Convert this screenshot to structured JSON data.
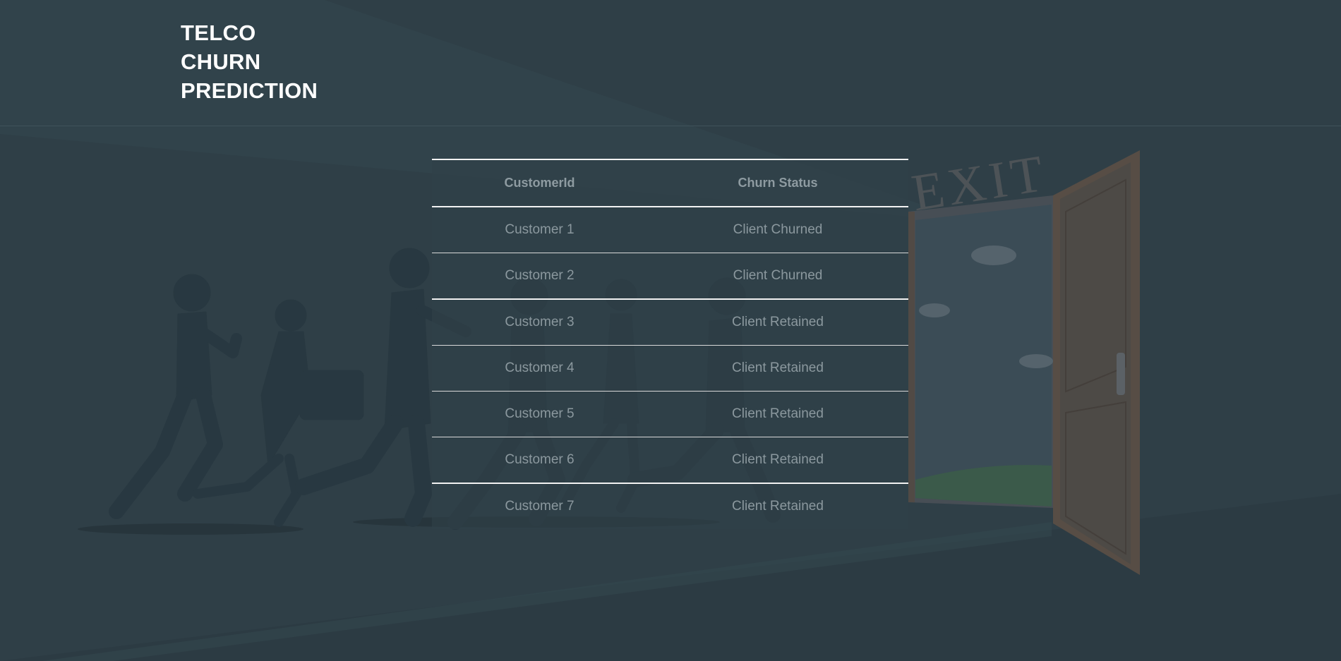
{
  "header": {
    "title_lines": [
      "TELCO",
      "CHURN",
      "PREDICTION"
    ]
  },
  "illustration": {
    "sign_text": "EXIT"
  },
  "table": {
    "columns": [
      "CustomerId",
      "Churn Status"
    ],
    "rows": [
      {
        "customer": "Customer 1",
        "status": "Client Churned"
      },
      {
        "customer": "Customer 2",
        "status": "Client Churned"
      },
      {
        "customer": "Customer 3",
        "status": "Client Retained"
      },
      {
        "customer": "Customer 4",
        "status": "Client Retained"
      },
      {
        "customer": "Customer 5",
        "status": "Client Retained"
      },
      {
        "customer": "Customer 6",
        "status": "Client Retained"
      },
      {
        "customer": "Customer 7",
        "status": "Client Retained"
      }
    ]
  },
  "colors": {
    "background": "#2f3f47",
    "header_text": "#ffffff",
    "table_text": "#8b989e"
  }
}
